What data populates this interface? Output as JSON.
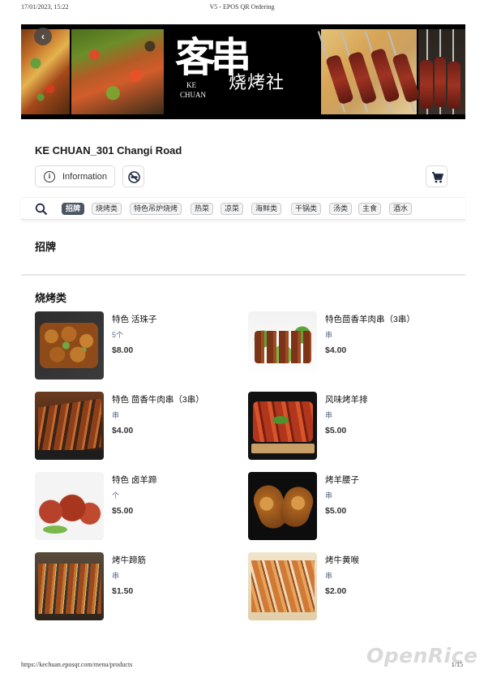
{
  "print_header": {
    "datetime": "17/01/2023, 15:22",
    "title": "V5 - EPOS QR Ordering"
  },
  "print_footer": {
    "url": "https://kechuan.eposqr.com/menu/products",
    "page": "1/15"
  },
  "watermark": "OpenRice",
  "banner": {
    "logo_big": "客串",
    "logo_sub_line1": "KE",
    "logo_sub_line2": "CHUAN",
    "logo_calligraphy": "烧烤社"
  },
  "back_button": {
    "icon": "chevron-left-icon",
    "glyph": "‹"
  },
  "store": {
    "name": "KE CHUAN_301 Changi Road"
  },
  "buttons": {
    "information": "Information",
    "information_glyph": "i",
    "no_smoking_icon": "no-smoking-icon",
    "cart_icon": "cart-icon"
  },
  "categories": [
    {
      "label": "招牌",
      "active": true
    },
    {
      "label": "烧烤类",
      "active": false
    },
    {
      "label": "特色吊炉烧烤",
      "active": false
    },
    {
      "label": "热菜",
      "active": false
    },
    {
      "label": "凉菜",
      "active": false
    },
    {
      "label": "海鲜类",
      "active": false
    },
    {
      "label": "干锅类",
      "active": false
    },
    {
      "label": "汤类",
      "active": false
    },
    {
      "label": "主食",
      "active": false
    },
    {
      "label": "酒水",
      "active": false
    }
  ],
  "sections": {
    "signature": {
      "title": "招牌"
    },
    "bbq": {
      "title": "烧烤类",
      "items": [
        {
          "name": "特色 活珠子",
          "unit": "5个",
          "price": "$8.00"
        },
        {
          "name": "特色茴香羊肉串（3串）",
          "unit": "串",
          "price": "$4.00"
        },
        {
          "name": "特色 茴香牛肉串（3串）",
          "unit": "串",
          "price": "$4.00"
        },
        {
          "name": "风味烤羊排",
          "unit": "串",
          "price": "$5.00"
        },
        {
          "name": "特色 卤羊蹄",
          "unit": "个",
          "price": "$5.00"
        },
        {
          "name": "烤羊腰子",
          "unit": "串",
          "price": "$5.00"
        },
        {
          "name": "烤牛蹄筋",
          "unit": "串",
          "price": "$1.50"
        },
        {
          "name": "烤牛黄喉",
          "unit": "串",
          "price": "$2.00"
        }
      ]
    }
  },
  "colors": {
    "active_chip": "#4b5563",
    "unit_text": "#5b6b8a",
    "divider": "#e6e6e6"
  }
}
